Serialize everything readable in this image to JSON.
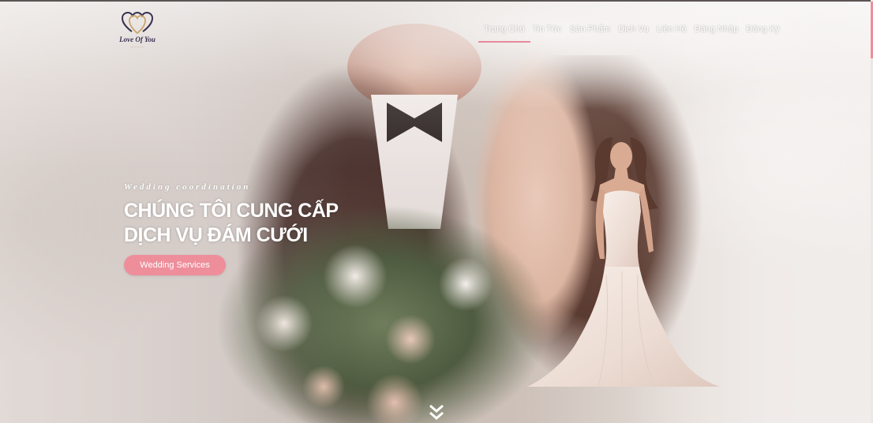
{
  "brand": {
    "logo_text": "Love Of You",
    "accent_color": "#ee8e9b"
  },
  "nav": {
    "items": [
      {
        "label": "Trang Chủ",
        "active": true
      },
      {
        "label": "Tin Tức",
        "active": false
      },
      {
        "label": "Sản Phẩm",
        "active": false
      },
      {
        "label": "Dịch Vụ",
        "active": false
      },
      {
        "label": "Liên Hệ",
        "active": false
      },
      {
        "label": "Đăng Nhập",
        "active": false
      },
      {
        "label": "Đăng Ký",
        "active": false
      }
    ]
  },
  "hero": {
    "tagline": "Wedding coordination",
    "headline_line1": "CHÚNG TÔI CUNG CẤP",
    "headline_line2": "DỊCH VỤ ĐÁM CƯỚI",
    "cta_label": "Wedding Services",
    "scroll_icon": "double-chevron-down-icon"
  }
}
